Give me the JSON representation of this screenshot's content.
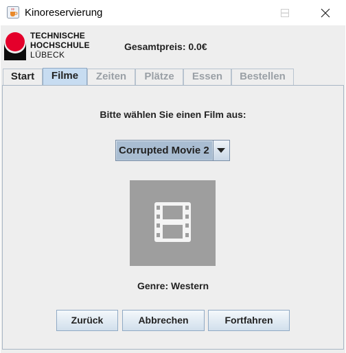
{
  "window": {
    "title": "Kinoreservierung",
    "icon": "java-cup-icon"
  },
  "header": {
    "logo_lines": [
      "TECHNISCHE",
      "HOCHSCHULE",
      "LÜBECK"
    ],
    "price_text": "Gesamtpreis: 0.0€"
  },
  "tabs": [
    {
      "label": "Start",
      "state": "normal"
    },
    {
      "label": "Filme",
      "state": "selected"
    },
    {
      "label": "Zeiten",
      "state": "disabled"
    },
    {
      "label": "Plätze",
      "state": "disabled"
    },
    {
      "label": "Essen",
      "state": "disabled"
    },
    {
      "label": "Bestellen",
      "state": "disabled"
    }
  ],
  "main": {
    "prompt": "Bitte wählen Sie einen Film aus:",
    "movie_select": {
      "selected": "Corrupted Movie 2"
    },
    "poster_icon": "film-icon",
    "genre_text": "Genre: Western"
  },
  "buttons": {
    "back": "Zurück",
    "cancel": "Abbrechen",
    "next": "Fortfahren"
  },
  "colors": {
    "selected_tab": "#c7dcf1",
    "poster_bg": "#9e9e9e",
    "logo_red": "#e4002b"
  }
}
